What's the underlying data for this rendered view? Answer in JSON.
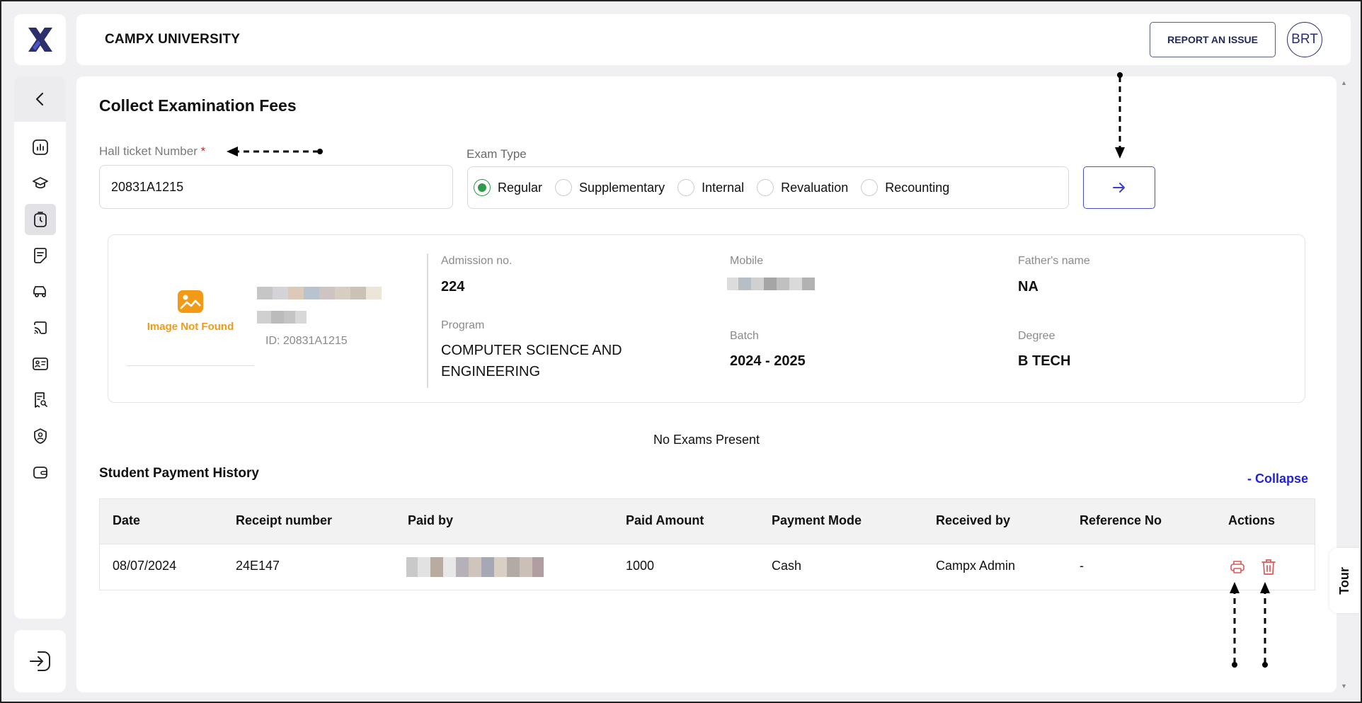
{
  "header": {
    "brand": "CAMPX UNIVERSITY",
    "report_label": "REPORT AN ISSUE",
    "avatar_initials": "BRT"
  },
  "sidebar": {
    "icons": [
      "back-icon",
      "dashboard-icon",
      "graduation-cap-icon",
      "exam-clock-icon",
      "document-icon",
      "fees-car-icon",
      "cast-icon",
      "id-card-icon",
      "receipt-search-icon",
      "user-shield-icon",
      "wallet-icon"
    ],
    "active": "exam-clock-icon"
  },
  "page": {
    "title": "Collect Examination Fees",
    "hall_label": "Hall ticket Number",
    "hall_required": "*",
    "hall_value": "20831A1215",
    "exam_type_label": "Exam Type",
    "exam_types": [
      "Regular",
      "Supplementary",
      "Internal",
      "Revaluation",
      "Recounting"
    ],
    "exam_type_selected": "Regular"
  },
  "student": {
    "image_not_found": "Image Not Found",
    "id_text": "ID: 20831A1215",
    "admission_label": "Admission no.",
    "admission_value": "224",
    "mobile_label": "Mobile",
    "father_label": "Father's name",
    "father_value": "NA",
    "program_label": "Program",
    "program_line1": "COMPUTER SCIENCE AND",
    "program_line2": "ENGINEERING",
    "batch_label": "Batch",
    "batch_value": "2024 - 2025",
    "degree_label": "Degree",
    "degree_value": "B TECH"
  },
  "exams": {
    "empty_text": "No Exams Present"
  },
  "payment_history": {
    "title": "Student Payment History",
    "collapse_label": "- Collapse",
    "columns": [
      "Date",
      "Receipt number",
      "Paid by",
      "Paid Amount",
      "Payment Mode",
      "Received by",
      "Reference No",
      "Actions"
    ],
    "rows": [
      {
        "date": "08/07/2024",
        "receipt": "24E147",
        "amount": "1000",
        "mode": "Cash",
        "received_by": "Campx Admin",
        "reference": "-"
      }
    ]
  },
  "tour_label": "Tour",
  "colors": {
    "accent_blue": "#2323d6",
    "brand_navy": "#2b2f6b",
    "radio_green": "#2e9a4a",
    "warning_orange": "#f29a16",
    "danger_red": "#e05555"
  }
}
